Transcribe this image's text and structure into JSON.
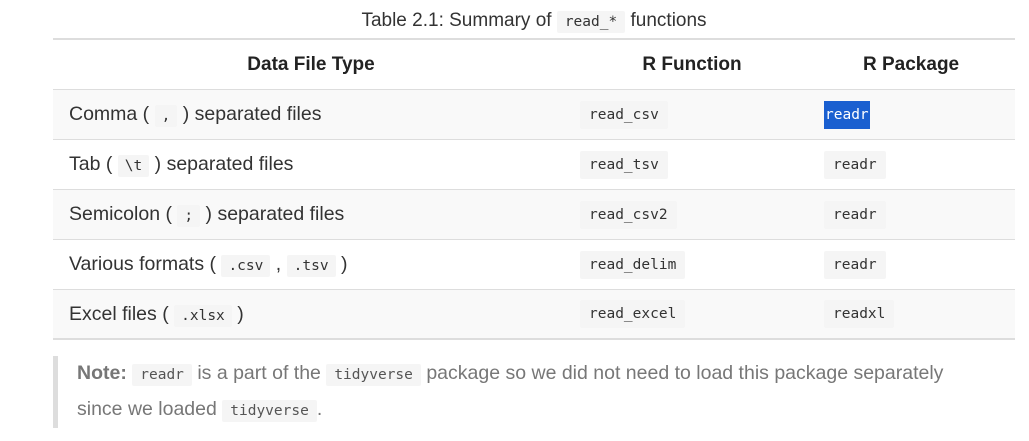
{
  "caption": {
    "prefix": "Table 2.1: Summary of",
    "code": "read_*",
    "suffix": "functions"
  },
  "table": {
    "headers": [
      "Data File Type",
      "R Function",
      "R Package"
    ],
    "rows": [
      {
        "type_before": "Comma (",
        "type_code": ",",
        "type_after": ") separated files",
        "function": "read_csv",
        "package": "readr"
      },
      {
        "type_before": "Tab (",
        "type_code": "\\t",
        "type_after": ") separated files",
        "function": "read_tsv",
        "package": "readr"
      },
      {
        "type_before": "Semicolon (",
        "type_code": ";",
        "type_after": ") separated files",
        "function": "read_csv2",
        "package": "readr"
      },
      {
        "type_before": "Various formats (",
        "type_code": ".csv",
        "type_mid": ",",
        "type_code2": ".tsv",
        "type_after": ")",
        "function": "read_delim",
        "package": "readr"
      },
      {
        "type_before": "Excel files (",
        "type_code": ".xlsx",
        "type_after": ")",
        "function": "read_excel",
        "package": "readxl"
      }
    ]
  },
  "note": {
    "label": "Note:",
    "code1": "readr",
    "text1": "is a part of the",
    "code2": "tidyverse",
    "text2": "package so we did not need to load this package separately since we loaded",
    "code3": "tidyverse",
    "text3": "."
  }
}
